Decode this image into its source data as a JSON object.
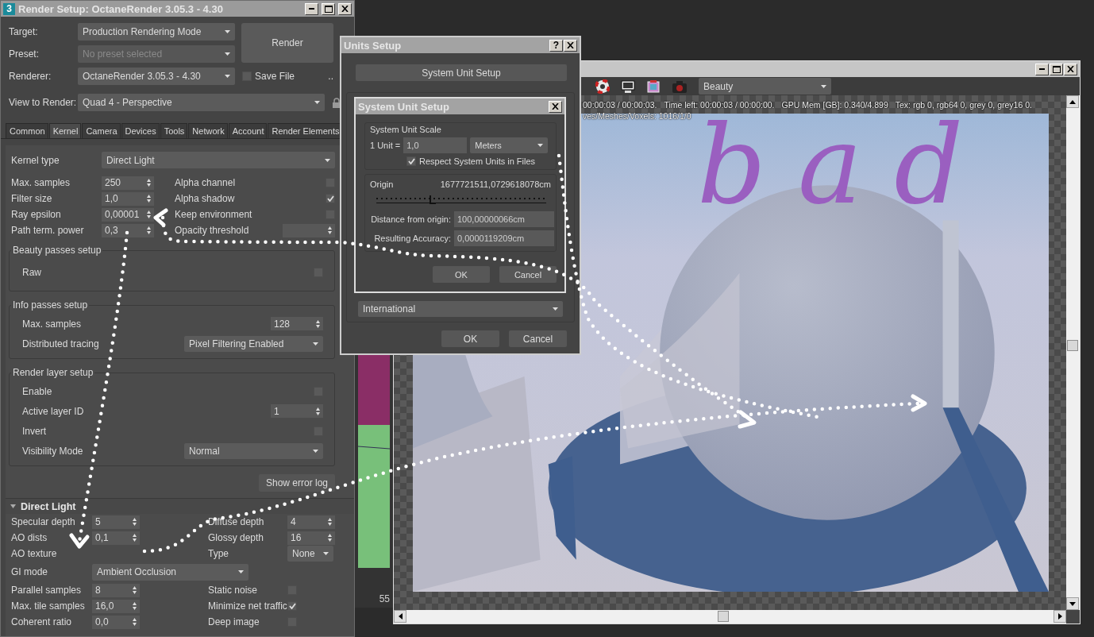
{
  "render_setup": {
    "app_badge": "3",
    "title": "Render Setup: OctaneRender 3.05.3 - 4.30",
    "form": [
      {
        "label": "Target:",
        "value": "Production Rendering Mode",
        "disabled": false
      },
      {
        "label": "Preset:",
        "value": "No preset selected",
        "disabled": true
      },
      {
        "label": "Renderer:",
        "value": "OctaneRender 3.05.3 - 4.30",
        "disabled": false
      }
    ],
    "render_button": "Render",
    "save_file": {
      "label": "Save File",
      "checked": false
    },
    "more_button": "..",
    "view_to_render": {
      "label": "View to Render:",
      "value": "Quad 4 - Perspective"
    },
    "tabs": [
      {
        "label": "Common",
        "selected": false
      },
      {
        "label": "Kernel",
        "selected": true
      },
      {
        "label": "Camera",
        "selected": false
      },
      {
        "label": "Devices",
        "selected": false
      },
      {
        "label": "Tools",
        "selected": false
      },
      {
        "label": "Network",
        "selected": false
      },
      {
        "label": "Account",
        "selected": false
      },
      {
        "label": "Render Elements",
        "selected": false
      }
    ],
    "kernel_type": {
      "label": "Kernel type",
      "value": "Direct Light"
    },
    "kernel_rows": [
      {
        "label": "Max. samples",
        "value": "250",
        "option": {
          "kind": "checkbox",
          "label": "Alpha channel",
          "checked": false
        }
      },
      {
        "label": "Filter size",
        "value": "1,0",
        "option": {
          "kind": "checkbox",
          "label": "Alpha shadow",
          "checked": true
        }
      },
      {
        "label": "Ray epsilon",
        "value": "0,00001",
        "option": {
          "kind": "checkbox",
          "label": "Keep environment",
          "checked": false
        }
      },
      {
        "label": "Path term. power",
        "value": "0,3",
        "option": {
          "kind": "spinner",
          "label": "Opacity threshold"
        }
      }
    ],
    "groups": [
      {
        "title": "Beauty passes setup",
        "rows": [
          {
            "kind": "checkbox",
            "label": "Raw",
            "checked": false
          }
        ]
      },
      {
        "title": "Info passes setup",
        "rows": [
          {
            "kind": "spinner",
            "label": "Max. samples",
            "value": "128"
          },
          {
            "kind": "dropdown",
            "label": "Distributed tracing",
            "value": "Pixel Filtering Enabled"
          }
        ]
      },
      {
        "title": "Render layer setup",
        "rows": [
          {
            "kind": "checkbox",
            "label": "Enable",
            "checked": false
          },
          {
            "kind": "spinner",
            "label": "Active layer ID",
            "value": "1"
          },
          {
            "kind": "checkbox",
            "label": "Invert",
            "checked": false
          },
          {
            "kind": "dropdown",
            "label": "Visibility Mode",
            "value": "Normal"
          }
        ]
      }
    ],
    "error_log_button": "Show error log",
    "direct_light": {
      "title": "Direct Light",
      "expanded": true,
      "rows": [
        {
          "left": {
            "kind": "spinner",
            "label": "Specular depth",
            "value": "5"
          },
          "right": {
            "kind": "spinner",
            "label": "Diffuse depth",
            "value": "4"
          }
        },
        {
          "left": {
            "kind": "spinner",
            "label": "AO dists",
            "value": "0,1"
          },
          "right": {
            "kind": "spinner",
            "label": "Glossy depth",
            "value": "16"
          }
        },
        {
          "left": {
            "kind": "label",
            "label": "AO texture"
          },
          "right": {
            "kind": "dropdown",
            "label": "Type",
            "value": "None"
          }
        },
        {
          "left": {
            "kind": "dropdown",
            "label": "GI mode",
            "value": "Ambient Occlusion"
          }
        },
        {
          "left": {
            "kind": "spinner",
            "label": "Parallel samples",
            "value": "8"
          },
          "right": {
            "kind": "checkbox",
            "label": "Static noise",
            "checked": false
          }
        },
        {
          "left": {
            "kind": "spinner",
            "label": "Max. tile samples",
            "value": "16,0"
          },
          "right": {
            "kind": "checkbox",
            "label": "Minimize net traffic",
            "checked": true
          }
        },
        {
          "left": {
            "kind": "spinner",
            "label": "Coherent ratio",
            "value": "0,0"
          },
          "right": {
            "kind": "checkbox",
            "label": "Deep image",
            "checked": false
          }
        }
      ]
    }
  },
  "units_setup": {
    "title": "Units Setup",
    "help_button": "?",
    "system_button": "System Unit Setup",
    "lighting_value": "International",
    "buttons": [
      "OK",
      "Cancel"
    ]
  },
  "system_unit_setup": {
    "title": "System Unit Setup",
    "scale_title": "System Unit Scale",
    "unit_label": "1 Unit =",
    "unit_value": "1,0",
    "unit_type": "Meters",
    "respect": {
      "label": "Respect System Units in Files",
      "checked": true
    },
    "origin_label": "Origin",
    "origin_value": "1677721511,0729618078cm",
    "origin_slider": {
      "level": 0.33
    },
    "distance": {
      "label": "Distance from origin:",
      "value": "100,00000066cm"
    },
    "accuracy": {
      "label": "Resulting Accuracy:",
      "value": "0,0000119209cm"
    },
    "buttons": [
      "OK",
      "Cancel"
    ]
  },
  "render_window": {
    "channel": "Beauty",
    "status_lines": [
      {
        "items": [
          "00:00:03 / 00:00:03.",
          "Time left: 00:00:03 / 00:00:00.",
          "GPU Mem [GB]: 0.340/4.899",
          "Tex: rgb 0, rgb64 0, grey 0, grey16 0."
        ]
      },
      {
        "items": [
          "ves/Meshes/Voxels: 1016/1/0"
        ]
      }
    ]
  },
  "viewport": {
    "timeline_label": "55"
  },
  "annotation": {
    "text": "bad"
  }
}
